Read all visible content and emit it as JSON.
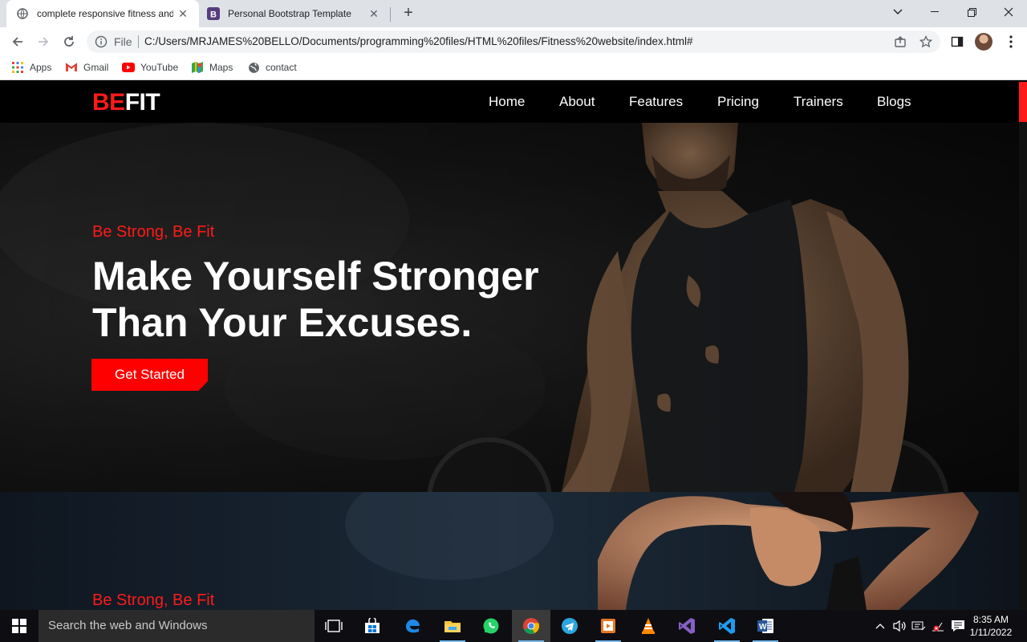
{
  "browser": {
    "tabs": [
      {
        "title": "complete responsive fitness and",
        "active": true
      },
      {
        "title": "Personal Bootstrap Template",
        "active": false
      }
    ],
    "address": {
      "scheme_label": "File",
      "url": "C:/Users/MRJAMES%20BELLO/Documents/programming%20files/HTML%20files/Fitness%20website/index.html#"
    },
    "bookmarks": [
      {
        "label": "Apps",
        "icon": "apps-grid-icon"
      },
      {
        "label": "Gmail",
        "icon": "gmail-icon"
      },
      {
        "label": "YouTube",
        "icon": "youtube-icon"
      },
      {
        "label": "Maps",
        "icon": "maps-icon"
      },
      {
        "label": "contact",
        "icon": "globe-icon"
      }
    ]
  },
  "site": {
    "logo": {
      "part1": "BE",
      "part2": "FIT"
    },
    "nav": [
      "Home",
      "About",
      "Features",
      "Pricing",
      "Trainers",
      "Blogs"
    ],
    "hero1": {
      "tagline": "Be Strong, Be Fit",
      "headline": "Make Yourself Stronger\nThan Your Excuses.",
      "cta": "Get Started"
    },
    "hero2": {
      "tagline": "Be Strong, Be Fit"
    },
    "accent_color": "#ff1a1a"
  },
  "taskbar": {
    "search_placeholder": "Search the web and Windows",
    "time": "8:35 AM",
    "date": "1/11/2022",
    "apps": [
      "task-view-icon",
      "store-icon",
      "edge-icon",
      "file-explorer-icon",
      "whatsapp-icon",
      "chrome-icon",
      "telegram-icon",
      "media-player-icon",
      "vlc-icon",
      "visual-studio-icon",
      "vscode-icon",
      "word-icon"
    ]
  }
}
